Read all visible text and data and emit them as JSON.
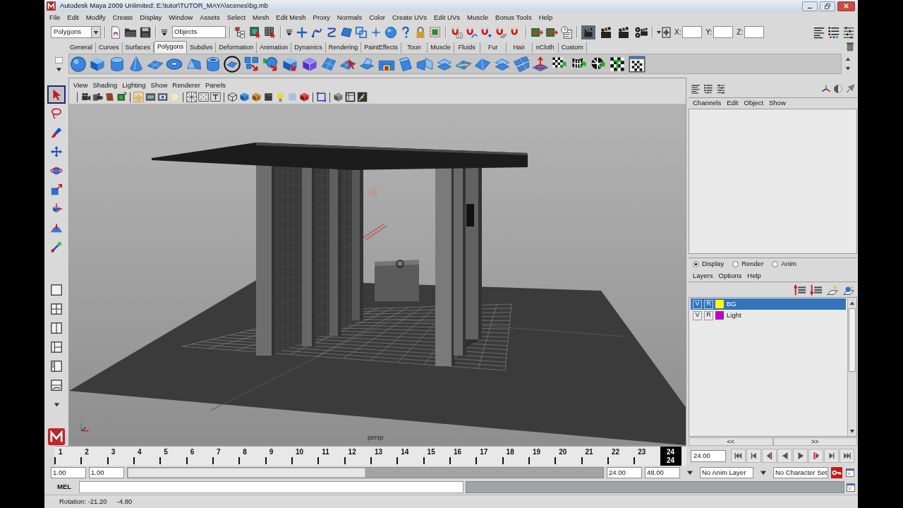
{
  "window": {
    "title": "Autodesk Maya 2009 Unlimited: E:\\tutor\\TUTOR_MAYA\\scenes\\bg.mb"
  },
  "menu_bar": [
    "File",
    "Edit",
    "Modify",
    "Create",
    "Display",
    "Window",
    "Assets",
    "Select",
    "Mesh",
    "Edit Mesh",
    "Proxy",
    "Normals",
    "Color",
    "Create UVs",
    "Edit UVs",
    "Muscle",
    "Bonus Tools",
    "Help"
  ],
  "status_line": {
    "menu_set": "Polygons",
    "selection_mode": "Objects",
    "transform_fields": [
      {
        "label": "X:"
      },
      {
        "label": "Y:"
      },
      {
        "label": "Z:"
      }
    ]
  },
  "shelf": {
    "tabs": [
      {
        "label": "General",
        "selected": false
      },
      {
        "label": "Curves",
        "selected": false
      },
      {
        "label": "Surfaces",
        "selected": false
      },
      {
        "label": "Polygons",
        "selected": true
      },
      {
        "label": "Subdivs",
        "selected": false
      },
      {
        "label": "Deformation",
        "selected": false
      },
      {
        "label": "Animation",
        "selected": false
      },
      {
        "label": "Dynamics",
        "selected": false
      },
      {
        "label": "Rendering",
        "selected": false
      },
      {
        "label": "PaintEffects",
        "selected": false
      },
      {
        "label": "Toon",
        "selected": false
      },
      {
        "label": "Muscle",
        "selected": false
      },
      {
        "label": "Fluids",
        "selected": false
      },
      {
        "label": "Fur",
        "selected": false
      },
      {
        "label": "Hair",
        "selected": false
      },
      {
        "label": "nCloth",
        "selected": false
      },
      {
        "label": "Custom",
        "selected": false
      }
    ]
  },
  "toolbox": {
    "tools": [
      {
        "selected": true
      },
      {
        "selected": false
      },
      {
        "selected": false
      },
      {
        "selected": false
      },
      {
        "selected": false
      },
      {
        "selected": false
      },
      {
        "selected": false
      },
      {
        "selected": false
      },
      {
        "selected": false
      }
    ]
  },
  "viewport": {
    "menu": [
      "View",
      "Shading",
      "Lighting",
      "Show",
      "Renderer",
      "Panels"
    ],
    "camera": "persp"
  },
  "channel_box": {
    "menu": [
      "Channels",
      "Edit",
      "Object",
      "Show"
    ]
  },
  "layer_editor": {
    "modes": [
      {
        "label": "Display",
        "selected": true
      },
      {
        "label": "Render",
        "selected": false
      },
      {
        "label": "Anim",
        "selected": false
      }
    ],
    "menu": [
      "Layers",
      "Options",
      "Help"
    ],
    "layers": [
      {
        "visibility": "V",
        "reference": "R",
        "color": "#ffff00",
        "name": "BG",
        "selected": true
      },
      {
        "visibility": "V",
        "reference": "R",
        "color": "#c000c0",
        "name": "Light",
        "selected": false
      }
    ],
    "pager": [
      "<<",
      ">>"
    ]
  },
  "time_slider": {
    "ticks": [
      {
        "label": "1",
        "selected": false
      },
      {
        "label": "2",
        "selected": false
      },
      {
        "label": "3",
        "selected": false
      },
      {
        "label": "4",
        "selected": false
      },
      {
        "label": "5",
        "selected": false
      },
      {
        "label": "6",
        "selected": false
      },
      {
        "label": "7",
        "selected": false
      },
      {
        "label": "8",
        "selected": false
      },
      {
        "label": "9",
        "selected": false
      },
      {
        "label": "10",
        "selected": false
      },
      {
        "label": "11",
        "selected": false
      },
      {
        "label": "12",
        "selected": false
      },
      {
        "label": "13",
        "selected": false
      },
      {
        "label": "14",
        "selected": false
      },
      {
        "label": "15",
        "selected": false
      },
      {
        "label": "16",
        "selected": false
      },
      {
        "label": "17",
        "selected": false
      },
      {
        "label": "18",
        "selected": false
      },
      {
        "label": "19",
        "selected": false
      },
      {
        "label": "20",
        "selected": false
      },
      {
        "label": "21",
        "selected": false
      },
      {
        "label": "22",
        "selected": false
      },
      {
        "label": "23",
        "selected": false
      },
      {
        "label": "24",
        "selected": true
      }
    ],
    "current_frame": "24",
    "current_time": "24.00"
  },
  "range_slider": {
    "start": "1.00",
    "playback_start": "1.00",
    "playback_end": "24.00",
    "end": "48.00",
    "level": 0.5
  },
  "playback_options": {
    "anim_layer": "No Anim Layer",
    "character_set": "No Character Set"
  },
  "command_line": {
    "label": "MEL"
  },
  "help_line": [
    "Rotation: -21.20",
    "-4.80"
  ]
}
